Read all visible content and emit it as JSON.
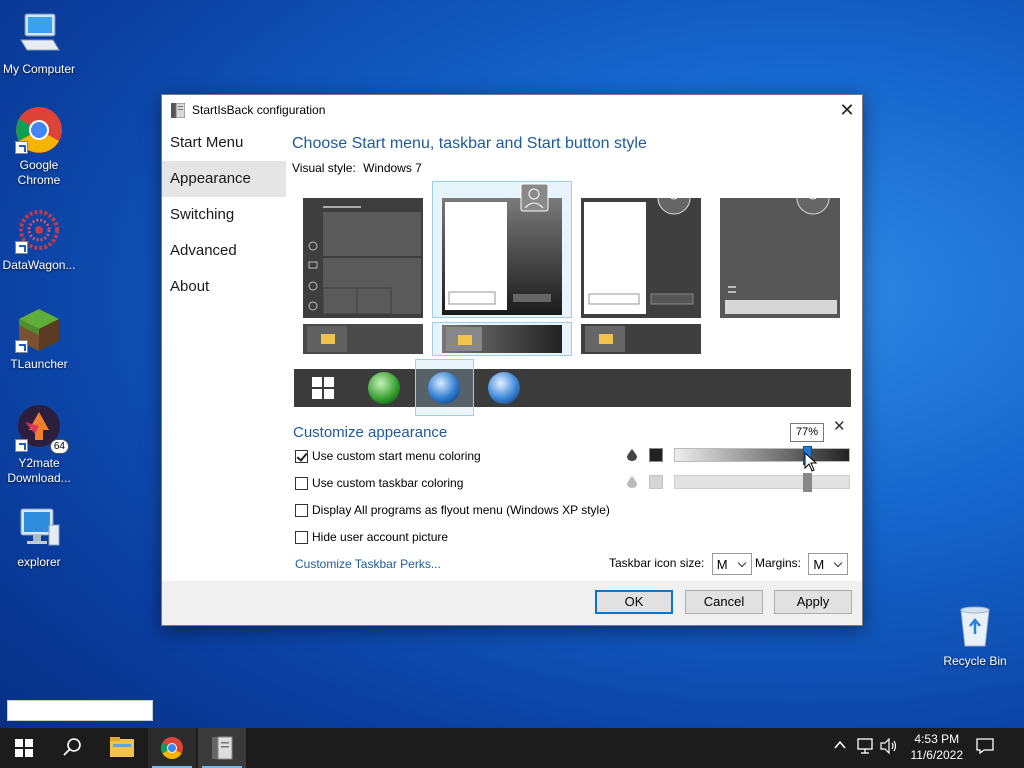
{
  "desktop": {
    "icons": [
      {
        "label": "My Computer"
      },
      {
        "label": "Google Chrome"
      },
      {
        "label": "DataWagon..."
      },
      {
        "label": "TLauncher"
      },
      {
        "label": "Y2mate Download..."
      },
      {
        "label": "explorer"
      },
      {
        "label": "Recycle Bin"
      }
    ],
    "y2mate_badge": "64"
  },
  "dialog": {
    "title": "StartIsBack configuration",
    "close_glyph": "✕",
    "nav": [
      "Start Menu",
      "Appearance",
      "Switching",
      "Advanced",
      "About"
    ],
    "active_nav": "Appearance",
    "heading": "Choose Start menu, taskbar and Start button style",
    "visual_style_label": "Visual style:",
    "visual_style_value": "Windows 7",
    "customize_heading": "Customize appearance",
    "checks": [
      {
        "label": "Use custom start menu coloring",
        "checked": true
      },
      {
        "label": "Use custom taskbar coloring",
        "checked": false
      },
      {
        "label": "Display All programs as flyout menu (Windows XP style)",
        "checked": false
      },
      {
        "label": "Hide user account picture",
        "checked": false
      }
    ],
    "tooltip": "77%",
    "start_menu_opacity_percent": 77,
    "link": "Customize Taskbar Perks...",
    "icon_size_label": "Taskbar icon size:",
    "icon_size_value": "M",
    "margins_label": "Margins:",
    "margins_value": "M",
    "buttons": {
      "ok": "OK",
      "cancel": "Cancel",
      "apply": "Apply"
    }
  },
  "taskbar": {
    "time": "4:53 PM",
    "date": "11/6/2022",
    "colors": {
      "bar": "#1c1c1c",
      "accent": "#0078d7"
    }
  }
}
